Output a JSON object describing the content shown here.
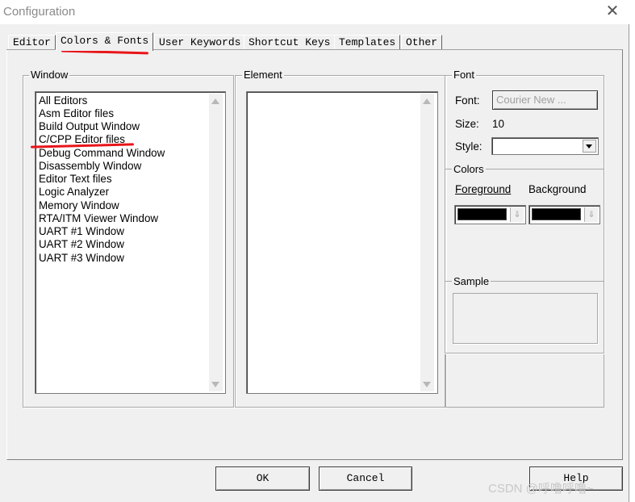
{
  "window": {
    "title": "Configuration",
    "close_glyph": "✕"
  },
  "tabs": [
    {
      "label": "Editor"
    },
    {
      "label": "Colors & Fonts"
    },
    {
      "label": "User Keywords"
    },
    {
      "label": "Shortcut Keys"
    },
    {
      "label": "Templates"
    },
    {
      "label": "Other"
    }
  ],
  "active_tab": "Colors & Fonts",
  "window_group": {
    "label": "Window",
    "items": [
      "All Editors",
      "Asm Editor files",
      "Build Output Window",
      "C/CPP Editor files",
      "Debug Command Window",
      "Disassembly Window",
      "Editor Text files",
      "Logic Analyzer",
      "Memory Window",
      "RTA/ITM Viewer Window",
      "UART #1 Window",
      "UART #2 Window",
      "UART #3 Window"
    ],
    "highlighted_item": "C/CPP Editor files"
  },
  "element_group": {
    "label": "Element",
    "items": []
  },
  "font_group": {
    "label": "Font",
    "font_label": "Font:",
    "font_button": "Courier New ...",
    "size_label": "Size:",
    "size_value": "10",
    "style_label": "Style:",
    "style_value": ""
  },
  "colors_group": {
    "label": "Colors",
    "foreground_label": "Foreground",
    "background_label": "Background",
    "foreground_color": "#000000",
    "background_color": "#000000"
  },
  "sample_group": {
    "label": "Sample"
  },
  "buttons": {
    "ok": "OK",
    "cancel": "Cancel",
    "help": "Help"
  },
  "watermark": "CSDN @呼噜呼噜~",
  "annotation_color": "#e8151a"
}
